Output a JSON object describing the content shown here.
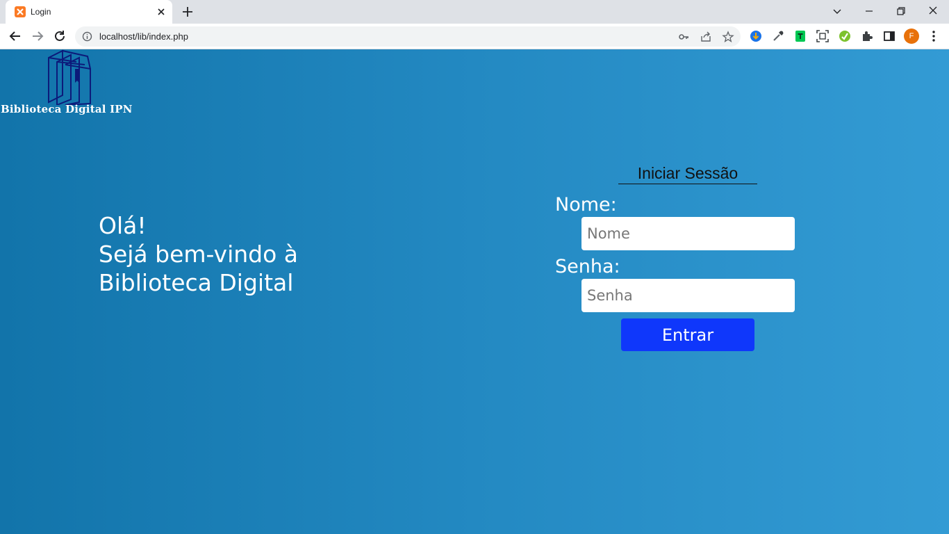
{
  "browser": {
    "tab_title": "Login",
    "url": "localhost/lib/index.php",
    "profile_initial": "F",
    "profile_color": "#e8710a"
  },
  "page": {
    "brand": "Biblioteca Digital IPN",
    "welcome": {
      "line1": "Olá!",
      "line2": "Sejá bem-vindo à",
      "line3": "Biblioteca Digital"
    },
    "login": {
      "title": "Iniciar Sessão",
      "name_label": "Nome:",
      "name_placeholder": "Nome",
      "password_label": "Senha:",
      "password_placeholder": "Senha",
      "submit_label": "Entrar"
    },
    "colors": {
      "background_start": "#1274aa",
      "background_end": "#339bd4",
      "button": "#0f37fb"
    }
  }
}
